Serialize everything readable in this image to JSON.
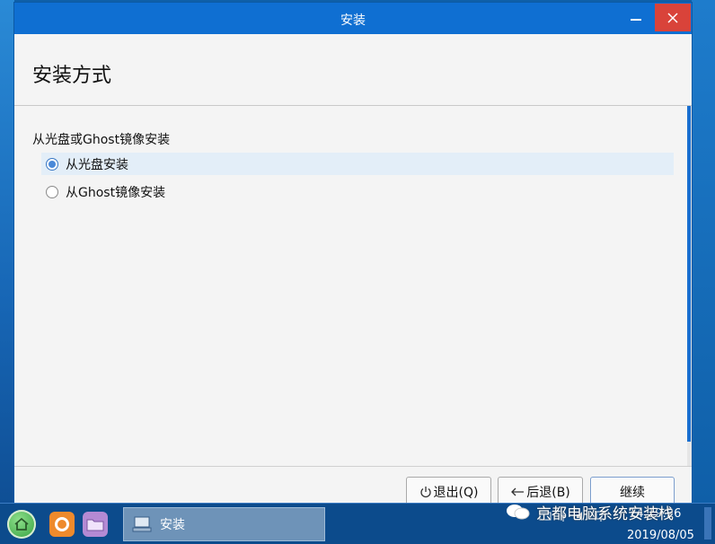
{
  "window": {
    "title": "安装",
    "heading": "安装方式"
  },
  "content": {
    "group_label": "从光盘或Ghost镜像安装",
    "options": [
      {
        "label": "从光盘安装",
        "selected": true
      },
      {
        "label": "从Ghost镜像安装",
        "selected": false
      }
    ]
  },
  "footer": {
    "quit_label": "退出(Q)",
    "back_label": "后退(B)",
    "next_label": "继续"
  },
  "taskbar": {
    "task_label": "安装",
    "clock_time": "14:19:26",
    "clock_date": "2019/08/05"
  },
  "watermark": {
    "text": "京都电脑系统安装栈"
  },
  "colors": {
    "titlebar": "#0f6fd2",
    "close_button": "#d9433a",
    "taskbar": "#0c4b8c",
    "scrollbar": "#1a6fd0"
  },
  "icons": [
    "close-icon",
    "minimize-icon",
    "power-icon",
    "back-arrow-icon",
    "home-icon",
    "firefox-icon",
    "folder-icon",
    "installer-icon",
    "wechat-icon"
  ]
}
